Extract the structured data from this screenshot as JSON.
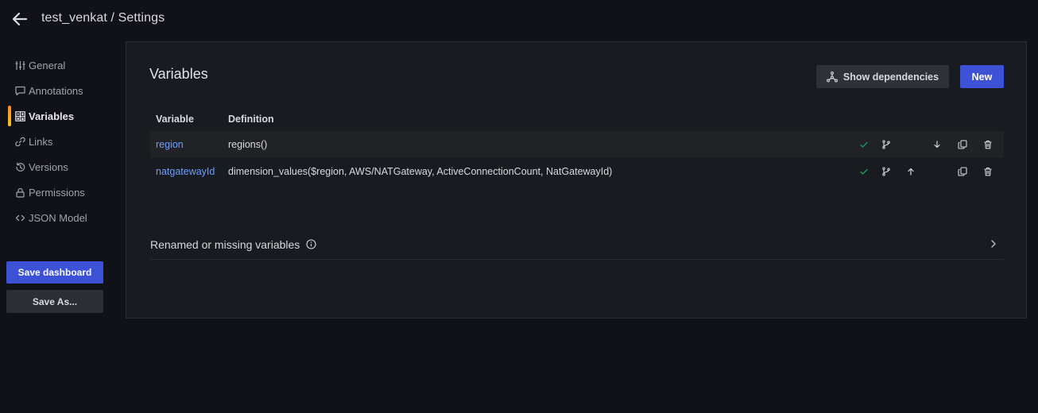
{
  "header": {
    "title": "test_venkat / Settings"
  },
  "sidebar": {
    "items": [
      {
        "label": "General",
        "icon": "sliders-icon"
      },
      {
        "label": "Annotations",
        "icon": "comment-icon"
      },
      {
        "label": "Variables",
        "icon": "calculator-icon",
        "active": true
      },
      {
        "label": "Links",
        "icon": "link-icon"
      },
      {
        "label": "Versions",
        "icon": "history-icon"
      },
      {
        "label": "Permissions",
        "icon": "lock-icon"
      },
      {
        "label": "JSON Model",
        "icon": "code-icon"
      }
    ],
    "save_label": "Save dashboard",
    "save_as_label": "Save As..."
  },
  "main": {
    "title": "Variables",
    "show_deps_label": "Show dependencies",
    "new_label": "New",
    "table": {
      "headers": [
        "Variable",
        "Definition"
      ],
      "rows": [
        {
          "name": "region",
          "definition": "regions()"
        },
        {
          "name": "natgatewayId",
          "definition": "dimension_values($region, AWS/NATGateway, ActiveConnectionCount, NatGatewayId)"
        }
      ]
    },
    "renamed_label": "Renamed or missing variables"
  },
  "colors": {
    "accent": "#3d51d6",
    "link": "#6e9fff",
    "success": "#1a7f4b",
    "active_bar_top": "#ff8833",
    "active_bar_bottom": "#f4c51b"
  }
}
